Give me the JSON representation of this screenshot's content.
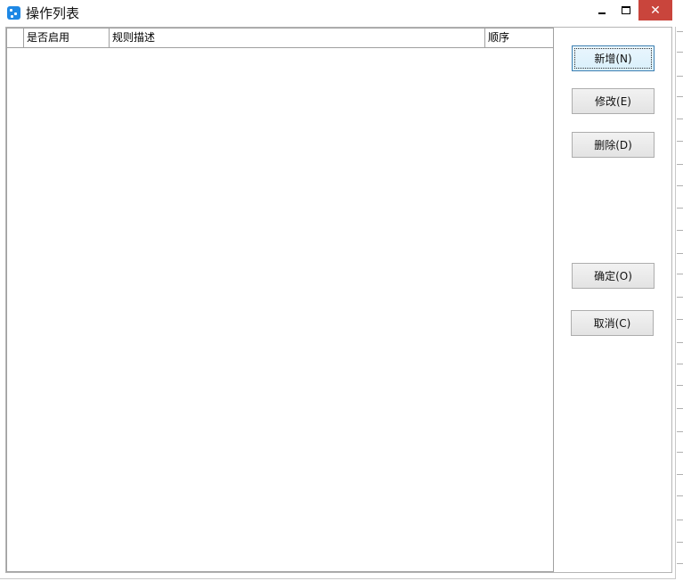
{
  "window": {
    "title": "操作列表",
    "controls": {
      "minimize": "minimize",
      "maximize": "maximize",
      "close": "✕"
    },
    "close_color": "#c9453c"
  },
  "grid": {
    "columns": [
      "",
      "是否启用",
      "规则描述",
      "顺序"
    ],
    "rows": []
  },
  "buttons": {
    "add": "新增(N)",
    "edit": "修改(E)",
    "delete": "删除(D)",
    "ok": "确定(O)",
    "cancel": "取消(C)"
  }
}
